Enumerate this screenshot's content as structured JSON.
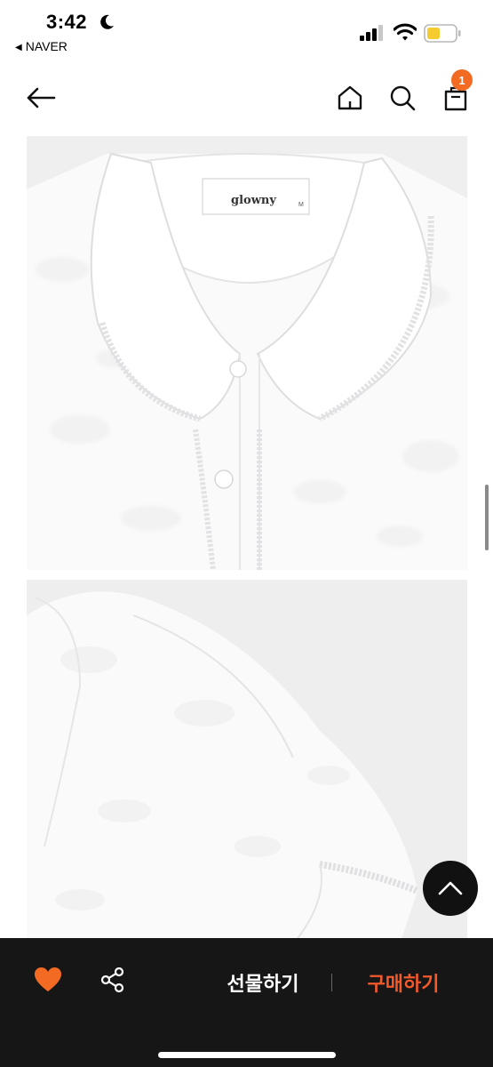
{
  "status_bar": {
    "time": "3:42",
    "back_app": "NAVER",
    "icons": [
      "moon-icon",
      "signal-icon",
      "wifi-icon",
      "battery-icon"
    ]
  },
  "header": {
    "cart_badge": "1",
    "icons": [
      "back-arrow-icon",
      "home-icon",
      "search-icon",
      "cart-icon"
    ]
  },
  "product": {
    "label_brand": "glowny",
    "label_size": "M"
  },
  "bottom_bar": {
    "gift_label": "선물하기",
    "buy_label": "구매하기",
    "icons": [
      "heart-icon",
      "share-icon"
    ]
  },
  "colors": {
    "accent": "#f36b22",
    "buy_text": "#f3592a",
    "bottom_bg": "#161616",
    "photo_bg": "#f1f1f2"
  }
}
